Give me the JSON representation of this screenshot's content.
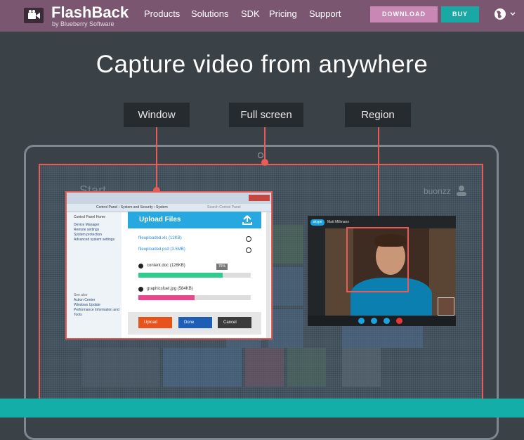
{
  "brand": {
    "name": "FlashBack",
    "sub": "by Blueberry Software"
  },
  "nav": {
    "items": [
      "Products",
      "Solutions",
      "SDK",
      "Pricing",
      "Support"
    ],
    "download": "DOWNLOAD",
    "buy": "BUY"
  },
  "hero": {
    "headline": "Capture video from anywhere"
  },
  "modes": {
    "window": "Window",
    "full": "Full screen",
    "region": "Region"
  },
  "screen": {
    "start": "Start",
    "user": "buonzz"
  },
  "window": {
    "address": "Control Panel › System and Security › System",
    "search_placeholder": "Search Control Panel",
    "side_home": "Control Panel Home",
    "side_links": [
      "Device Manager",
      "Remote settings",
      "System protection",
      "Advanced system settings"
    ],
    "side_see": "See also",
    "side_also": [
      "Action Center",
      "Windows Update",
      "Performance Information and Tools"
    ],
    "upload_title": "Upload Files",
    "uploaded": [
      "fileuploaded.xls (12KB)",
      "fileuploaded.psd (3.5MB)"
    ],
    "uploading": [
      {
        "name": "content.doc (126KB)",
        "progress": 0.75
      },
      {
        "name": "graphicsfuel.jpg (584KB)",
        "progress": 0.5
      }
    ],
    "pct_label": "75%",
    "buttons": {
      "upload": "Upload",
      "done": "Done",
      "cancel": "Cancel"
    }
  },
  "skype": {
    "title": "Matt Millmann",
    "logo": "skype"
  },
  "colors": {
    "nav": "#7b5670",
    "accent": "#e95b57",
    "teal": "#12aea7",
    "download": "#c987b6"
  }
}
